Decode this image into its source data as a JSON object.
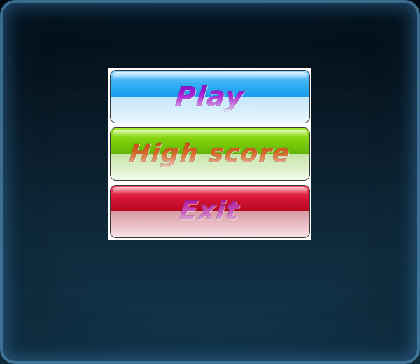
{
  "menu": {
    "buttons": [
      {
        "id": "play",
        "label": "Play",
        "color": "#2aa9f2",
        "text_color": "#a020d0"
      },
      {
        "id": "highscore",
        "label": "High score",
        "color": "#79cd0b",
        "text_color": "#d25a1c"
      },
      {
        "id": "exit",
        "label": "Exit",
        "color": "#d41430",
        "text_color": "#c030a8"
      }
    ]
  },
  "theme": {
    "background_top": "#03101a",
    "background_bottom": "#12364c",
    "frame_glow": "#5a96be",
    "panel": "#ffffff"
  }
}
